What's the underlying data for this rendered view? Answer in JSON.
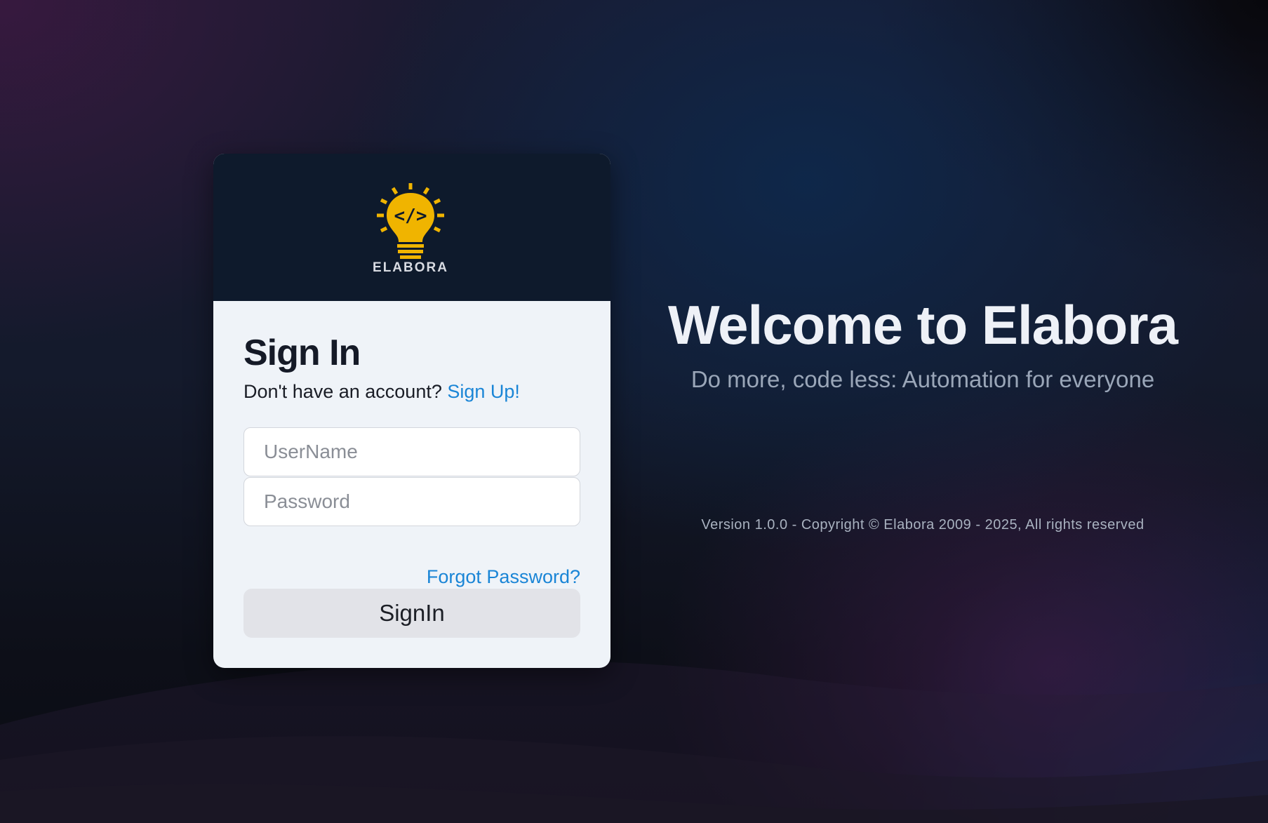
{
  "brand": {
    "logo_text": "ELABORA",
    "logo_glyph": "</>",
    "accent_color": "#f0b400"
  },
  "login": {
    "title": "Sign In",
    "account_prompt": "Don't have an account?",
    "signup_link": "Sign Up!",
    "username_placeholder": "UserName",
    "password_placeholder": "Password",
    "forgot_link": "Forgot Password?",
    "submit_label": "SignIn"
  },
  "hero": {
    "heading": "Welcome to Elabora",
    "tagline": "Do more, code less: Automation for everyone",
    "footer": "Version 1.0.0 - Copyright © Elabora 2009 - 2025, All rights reserved"
  },
  "colors": {
    "link": "#1a85d6",
    "card_header": "#0e1a2c",
    "card_body": "#eff3f8",
    "button": "#e2e3e8"
  }
}
